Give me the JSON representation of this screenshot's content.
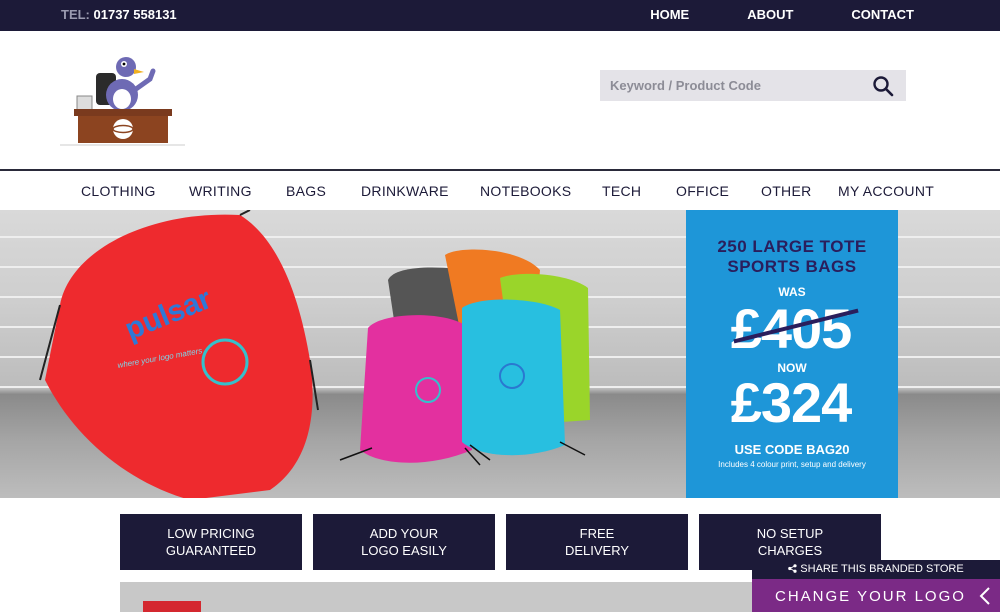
{
  "topbar": {
    "tel_label": "TEL:",
    "tel_number": "01737 558131",
    "links": [
      "HOME",
      "ABOUT",
      "CONTACT"
    ]
  },
  "header": {
    "search_placeholder": "Keyword / Product Code"
  },
  "nav": {
    "items": [
      "CLOTHING",
      "WRITING",
      "BAGS",
      "DRINKWARE",
      "NOTEBOOKS",
      "TECH",
      "OFFICE",
      "OTHER",
      "MY ACCOUNT"
    ]
  },
  "banner": {
    "bag_brand": "pulsar",
    "bag_tagline": "where your logo matters"
  },
  "promo": {
    "title_line1": "250 LARGE TOTE",
    "title_line2": "SPORTS BAGS",
    "was_label": "WAS",
    "old_price": "£405",
    "now_label": "NOW",
    "new_price": "£324",
    "code_text": "USE CODE BAG20",
    "includes_text": "Includes 4 colour print, setup and delivery"
  },
  "features": [
    {
      "line1": "LOW PRICING",
      "line2": "GUARANTEED"
    },
    {
      "line1": "ADD YOUR",
      "line2": "LOGO EASILY"
    },
    {
      "line1": "FREE",
      "line2": "DELIVERY"
    },
    {
      "line1": "NO SETUP",
      "line2": "CHARGES"
    }
  ],
  "floating": {
    "share_text": "SHARE THIS BRANDED STORE",
    "change_logo_text": "CHANGE YOUR LOGO"
  },
  "colors": {
    "dark_navy": "#1c1a38",
    "promo_blue": "#1e96d8",
    "promo_title": "#2a1e5c",
    "purple": "#7b2a86",
    "sale_red": "#d4282f"
  }
}
